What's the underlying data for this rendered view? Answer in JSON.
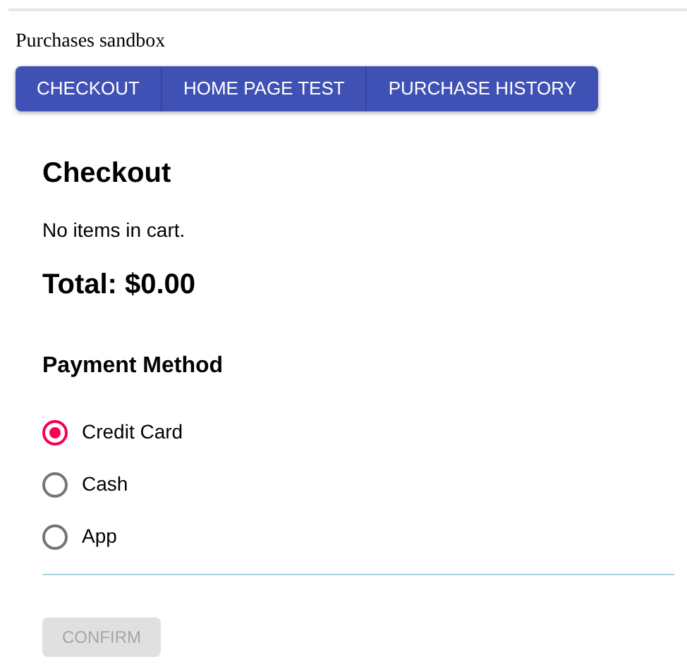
{
  "app_title": "Purchases sandbox",
  "nav_buttons": [
    "CHECKOUT",
    "HOME PAGE TEST",
    "PURCHASE HISTORY"
  ],
  "checkout": {
    "heading": "Checkout",
    "cart_message": "No items in cart.",
    "total": "Total: $0.00",
    "payment_heading": "Payment Method",
    "payment_options": [
      {
        "label": "Credit Card",
        "selected": true
      },
      {
        "label": "Cash",
        "selected": false
      },
      {
        "label": "App",
        "selected": false
      }
    ],
    "confirm_button": {
      "label": "CONFIRM",
      "disabled": true
    }
  }
}
